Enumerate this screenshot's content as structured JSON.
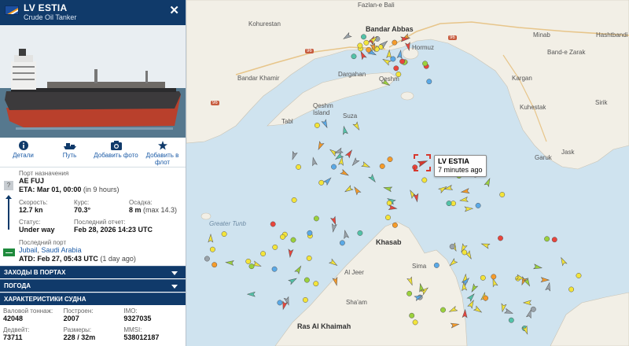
{
  "vessel": {
    "name": "LV ESTIA",
    "type": "Crude Oil Tanker",
    "close_icon": "close-icon"
  },
  "actions": [
    {
      "label": "Детали",
      "icon": "info-icon"
    },
    {
      "label": "Путь",
      "icon": "ship-track-icon"
    },
    {
      "label": "Добавить фото",
      "icon": "camera-icon"
    },
    {
      "label": "Добавить в флот",
      "icon": "star-icon"
    }
  ],
  "destination": {
    "label": "Порт назначения",
    "port": "AE FUJ",
    "eta_prefix": "ETA:",
    "eta": "Mar 01, 00:00",
    "eta_relative": "(in 9 hours)",
    "unknown_badge": "?"
  },
  "status": {
    "speed_label": "Скорость:",
    "speed": "12.7 kn",
    "course_label": "Курс:",
    "course": "70.3°",
    "draught_label": "Осадка:",
    "draught": "8 m",
    "draught_max": "(max 14.3)",
    "state_label": "Статус:",
    "state": "Under way",
    "last_report_label": "Последний отчет:",
    "last_report": "Feb 28, 2026 14:23 UTC"
  },
  "last_port": {
    "label": "Последний порт",
    "port": "Jubail",
    "country": "Saudi Arabia",
    "atd_prefix": "ATD:",
    "atd": "Feb 27, 05:43 UTC",
    "atd_relative": "(1 day ago)",
    "flag_text": "SA"
  },
  "sections": {
    "port_calls": "ЗАХОДЫ В ПОРТАХ",
    "weather": "ПОГОДА",
    "characteristics": "ХАРАКТЕРИСТИКИ СУДНА"
  },
  "specs": {
    "gt_label": "Валовой тоннаж:",
    "gt": "42048",
    "built_label": "Построен:",
    "built": "2007",
    "imo_label": "IMO:",
    "imo": "9327035",
    "dwt_label": "Дедвейт:",
    "dwt": "73711",
    "size_label": "Размеры:",
    "size": "228 / 32m",
    "mmsi_label": "MMSI:",
    "mmsi": "538012187"
  },
  "map": {
    "tooltip_name": "LV ESTIA",
    "tooltip_age": "7 minutes ago",
    "places": [
      {
        "name": "Fazlan-e Bali",
        "cls": ""
      },
      {
        "name": "Kohurestan",
        "cls": ""
      },
      {
        "name": "Bandar Abbas",
        "cls": "bold"
      },
      {
        "name": "Minab",
        "cls": ""
      },
      {
        "name": "Hashtbandi",
        "cls": ""
      },
      {
        "name": "Hormuz",
        "cls": ""
      },
      {
        "name": "Band-e Zarak",
        "cls": ""
      },
      {
        "name": "Dargahan",
        "cls": ""
      },
      {
        "name": "Qeshm",
        "cls": ""
      },
      {
        "name": "Bandar Khamir",
        "cls": ""
      },
      {
        "name": "Kargan",
        "cls": ""
      },
      {
        "name": "Qeshm Island",
        "cls": ""
      },
      {
        "name": "Kuhestak",
        "cls": ""
      },
      {
        "name": "Sirik",
        "cls": ""
      },
      {
        "name": "Tabl",
        "cls": ""
      },
      {
        "name": "Suza",
        "cls": ""
      },
      {
        "name": "Garuk",
        "cls": ""
      },
      {
        "name": "Jask",
        "cls": ""
      },
      {
        "name": "Greater Tunb",
        "cls": ""
      },
      {
        "name": "Khasab",
        "cls": "bold"
      },
      {
        "name": "Sima",
        "cls": ""
      },
      {
        "name": "Al Jeer",
        "cls": ""
      },
      {
        "name": "Sha'am",
        "cls": ""
      },
      {
        "name": "Ras Al Khaimah",
        "cls": "bold"
      }
    ],
    "road_numbers": [
      "96",
      "96",
      "96"
    ]
  },
  "colors": {
    "header_bg": "#103a6a",
    "link": "#1a5aa6",
    "sea": "#cfe3ef",
    "land": "#f2efe6",
    "selected": "#d7382d"
  }
}
